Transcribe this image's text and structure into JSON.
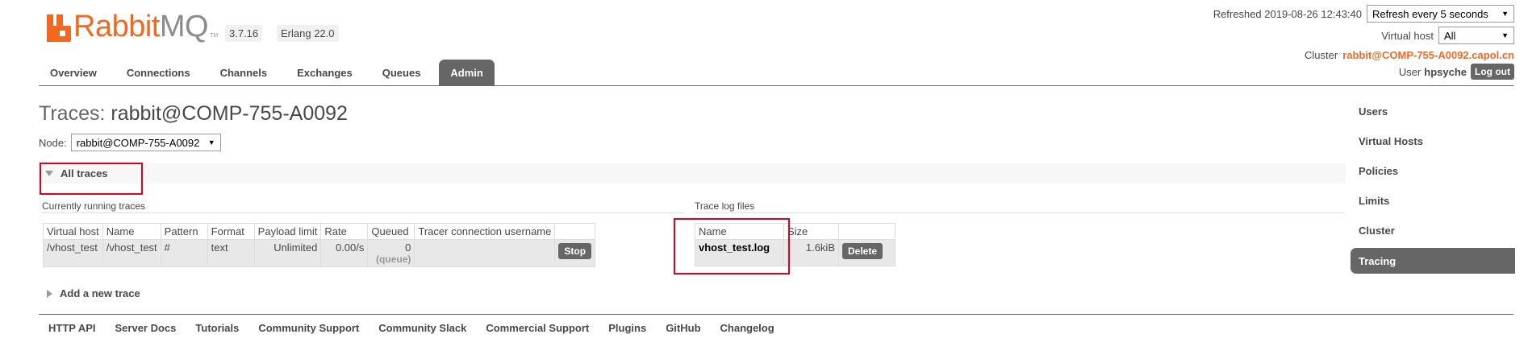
{
  "header": {
    "logo": {
      "part1": "Rabbit",
      "part2": "MQ",
      "tm": "TM"
    },
    "versions": {
      "rabbitmq": "3.7.16",
      "erlang": "Erlang 22.0"
    },
    "refreshed_label": "Refreshed 2019-08-26 12:43:40",
    "refresh_select": "Refresh every 5 seconds",
    "virtual_host_label": "Virtual host",
    "virtual_host_select": "All",
    "cluster_label": "Cluster",
    "cluster_name": "rabbit@COMP-755-A0092.capol.cn",
    "user_label": "User",
    "user_name": "hpsyche",
    "logout_label": "Log out"
  },
  "tabs": [
    "Overview",
    "Connections",
    "Channels",
    "Exchanges",
    "Queues",
    "Admin"
  ],
  "active_tab": "Admin",
  "right_nav": [
    "Users",
    "Virtual Hosts",
    "Policies",
    "Limits",
    "Cluster",
    "Tracing"
  ],
  "active_nav": "Tracing",
  "page": {
    "title_prefix": "Traces:",
    "title_node": "rabbit@COMP-755-A0092",
    "node_label": "Node:",
    "node_select": "rabbit@COMP-755-A0092",
    "section_all_traces": "All traces",
    "running_title": "Currently running traces",
    "running_headers": [
      "Virtual host",
      "Name",
      "Pattern",
      "Format",
      "Payload limit",
      "Rate",
      "Queued",
      "Tracer connection username",
      ""
    ],
    "running_rows": [
      {
        "vhost": "/vhost_test",
        "name": "/vhost_test",
        "pattern": "#",
        "format": "text",
        "payload_limit": "Unlimited",
        "rate": "0.00/s",
        "queued": "0",
        "queued_sub": "(queue)",
        "tracer_user": "",
        "action": "Stop"
      }
    ],
    "logs_title": "Trace log files",
    "logs_headers": [
      "Name",
      "Size",
      ""
    ],
    "logs_rows": [
      {
        "name": "vhost_test.log",
        "size": "1.6kiB",
        "action": "Delete"
      }
    ],
    "add_trace": "Add a new trace"
  },
  "footer": [
    "HTTP API",
    "Server Docs",
    "Tutorials",
    "Community Support",
    "Community Slack",
    "Commercial Support",
    "Plugins",
    "GitHub",
    "Changelog"
  ],
  "colors": {
    "brand": "#f26822",
    "tab_active": "#666666",
    "highlight": "#e0001b"
  }
}
